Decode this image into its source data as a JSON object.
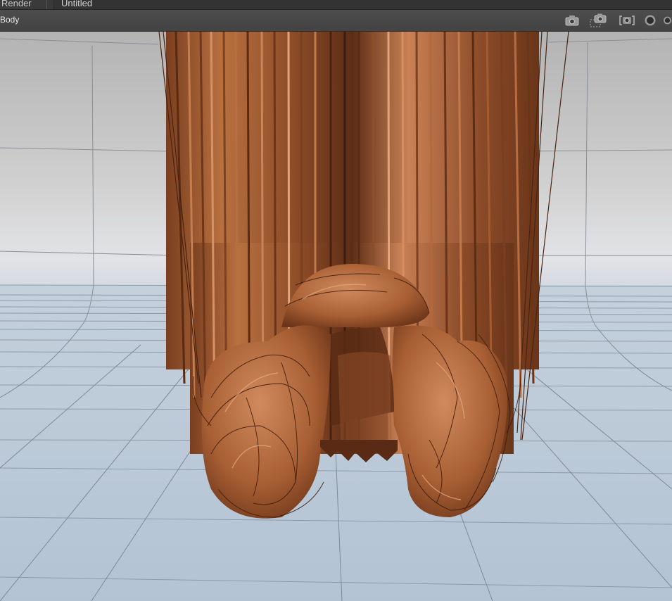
{
  "tabs": {
    "render_label": "Render",
    "document_title": "Untitled"
  },
  "toolbar": {
    "selection_label": "Body",
    "icons": [
      "camera-icon",
      "camera-region-icon",
      "render-frame-icon",
      "render-preview-icon",
      "render-final-icon"
    ]
  },
  "colors": {
    "floor": "#b8c6d6",
    "backdrop": "#c9c9c9",
    "hair": "#b2683f",
    "toolbar": "#474747"
  }
}
